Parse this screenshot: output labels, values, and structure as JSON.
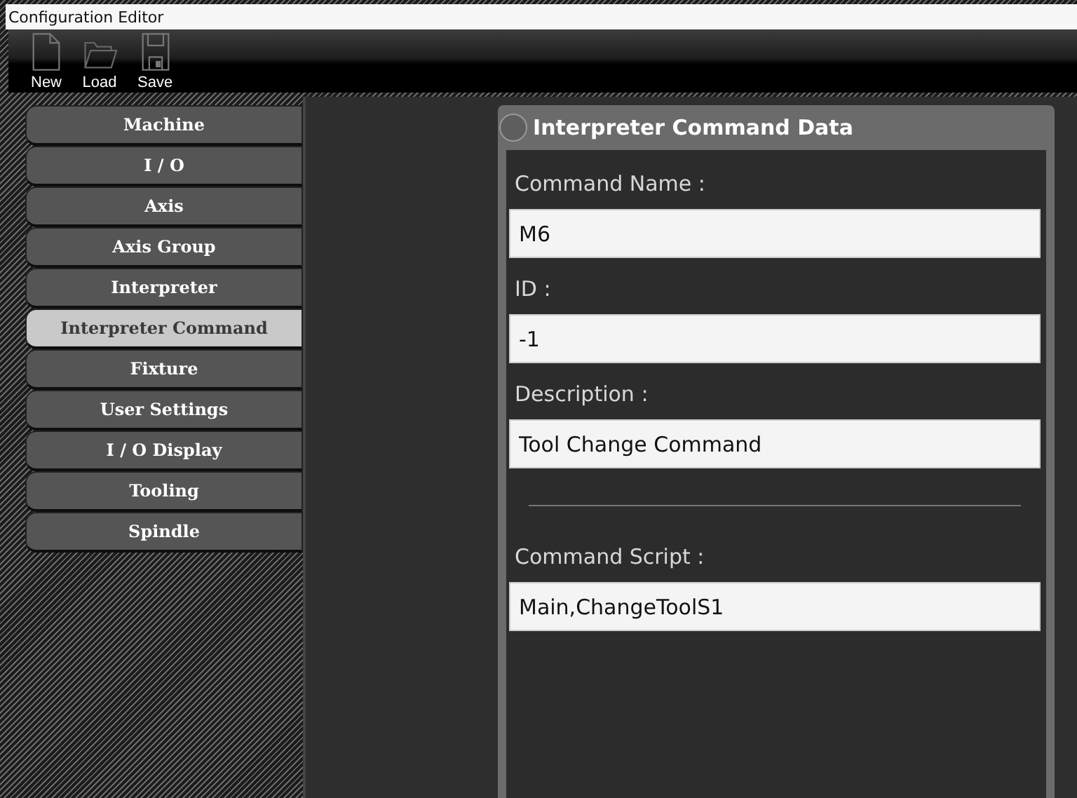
{
  "window": {
    "title": "Configuration Editor"
  },
  "toolbar": [
    {
      "kind": "new",
      "label": "New",
      "disabled": false
    },
    {
      "kind": "load",
      "label": "Load",
      "disabled": false
    },
    {
      "kind": "save",
      "label": "Save",
      "disabled": false
    }
  ],
  "sidebar": {
    "items": [
      {
        "label": "Machine",
        "selected": false
      },
      {
        "label": "I / O",
        "selected": false
      },
      {
        "label": "Axis",
        "selected": false
      },
      {
        "label": "Axis Group",
        "selected": false
      },
      {
        "label": "Interpreter",
        "selected": false
      },
      {
        "label": "Interpreter Command",
        "selected": true
      },
      {
        "label": "Fixture",
        "selected": false
      },
      {
        "label": "User Settings",
        "selected": false
      },
      {
        "label": "I / O Display",
        "selected": false
      },
      {
        "label": "Tooling",
        "selected": false
      },
      {
        "label": "Spindle",
        "selected": false
      }
    ]
  },
  "panel": {
    "title": "Interpreter Command Data",
    "fields": [
      {
        "kind": "field",
        "label": "Command Name :",
        "value": "M6"
      },
      {
        "kind": "field",
        "label": "ID :",
        "value": "-1"
      },
      {
        "kind": "field",
        "label": "Description :",
        "value": "Tool Change Command"
      },
      {
        "kind": "divider"
      },
      {
        "kind": "field",
        "label": "Command Script :",
        "value": "Main,ChangeToolS1"
      }
    ]
  }
}
